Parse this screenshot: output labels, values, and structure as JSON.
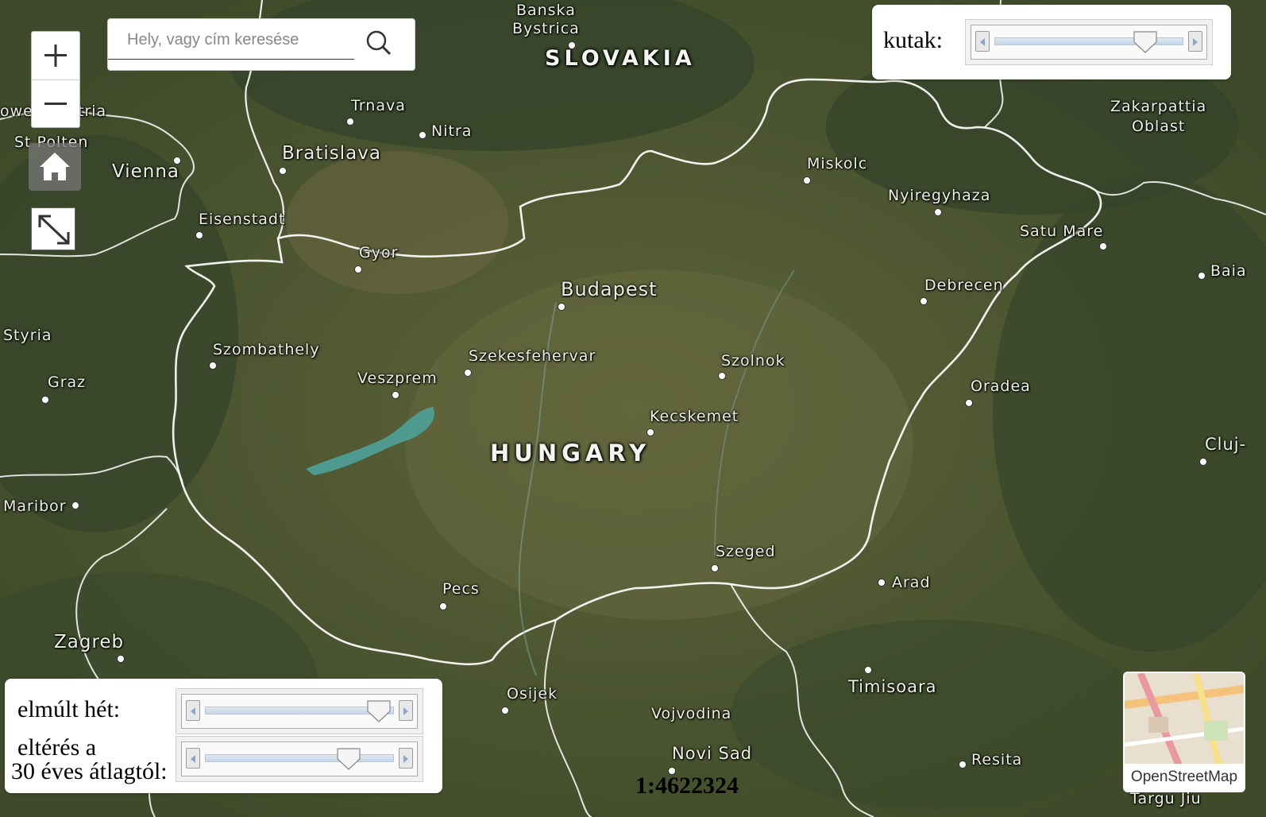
{
  "search": {
    "placeholder": "Hely, vagy cím keresése"
  },
  "controls": {
    "zoom_in": "+",
    "zoom_out": "−"
  },
  "layers": {
    "wells_label": "kutak:",
    "wells_value": 0.8,
    "last_week_label": "elmúlt hét:",
    "last_week_value": 0.92,
    "deviation_label_line1": "eltérés a",
    "deviation_label_line2": "30 éves átlagtól:",
    "deviation_value": 0.76
  },
  "scale": "1:4622324",
  "basemap": {
    "label": "OpenStreetMap"
  },
  "map": {
    "countries": [
      "SLOVAKIA",
      "HUNGARY"
    ],
    "cities": [
      "Banska Bystrica",
      "Trnava",
      "Nitra",
      "Bratislava",
      "Vienna",
      "Eisenstadt",
      "Gyor",
      "Miskolc",
      "Nyiregyhaza",
      "Satu Mare",
      "Baia",
      "Budapest",
      "Debrecen",
      "Szombathely",
      "Szekesfehervar",
      "Szolnok",
      "Veszprem",
      "Oradea",
      "Graz",
      "Styria",
      "Kecskemet",
      "Cluj-",
      "Maribor",
      "Szeged",
      "Arad",
      "Pecs",
      "Zagreb",
      "Osijek",
      "Timisoara",
      "Vojvodina",
      "Novi Sad",
      "Resita",
      "Zakarpattia Oblast",
      "St Polten",
      "owe",
      "tria",
      "Targu Jiu"
    ],
    "colors": {
      "land": "#4a5530",
      "border": "#ffffff",
      "lake": "#4f9a8e"
    }
  }
}
